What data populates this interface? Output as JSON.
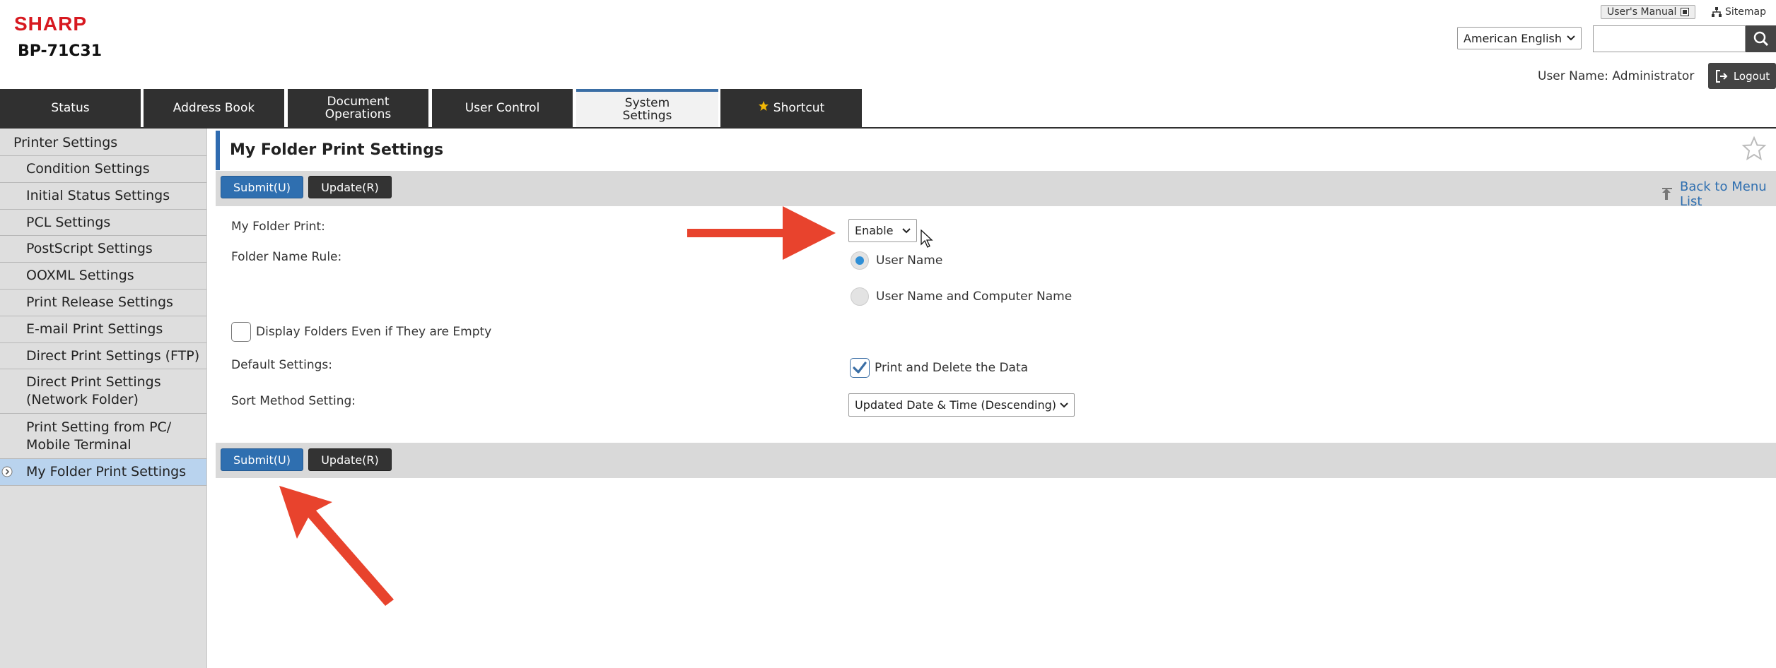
{
  "header": {
    "logo": "SHARP",
    "model": "BP-71C31",
    "user_manual": "User's Manual",
    "sitemap": "Sitemap",
    "language": "American English",
    "search_placeholder": "",
    "user_name_line": "User Name: Administrator",
    "logout": "Logout"
  },
  "tabs": [
    {
      "label": "Status",
      "active": false
    },
    {
      "label": "Address Book",
      "active": false
    },
    {
      "label": "Document\nOperations",
      "active": false
    },
    {
      "label": "User Control",
      "active": false
    },
    {
      "label": "System\nSettings",
      "active": true
    },
    {
      "label": "Shortcut",
      "active": false
    }
  ],
  "sidebar": {
    "items": [
      {
        "label": "Printer Settings"
      },
      {
        "label": "Condition Settings"
      },
      {
        "label": "Initial Status Settings"
      },
      {
        "label": "PCL Settings"
      },
      {
        "label": "PostScript Settings"
      },
      {
        "label": "OOXML Settings"
      },
      {
        "label": "Print Release Settings"
      },
      {
        "label": "E-mail Print Settings"
      },
      {
        "label": "Direct Print Settings (FTP)"
      },
      {
        "label": "Direct Print Settings\n(Network Folder)"
      },
      {
        "label": "Print Setting from PC/\nMobile Terminal"
      },
      {
        "label": "My Folder Print Settings",
        "active": true
      }
    ]
  },
  "main": {
    "title": "My Folder Print Settings",
    "submit": "Submit(U)",
    "update": "Update(R)",
    "back_to_menu": "Back to Menu List",
    "fields": {
      "my_folder_print_label": "My Folder Print:",
      "my_folder_print_value": "Enable",
      "folder_name_rule_label": "Folder Name Rule:",
      "radio_user_name": "User Name",
      "radio_user_name_computer": "User Name and Computer Name",
      "radio_selected": "User Name",
      "display_empty_folders": "Display Folders Even if They are Empty",
      "display_empty_folders_checked": false,
      "default_settings_label": "Default Settings:",
      "print_and_delete": "Print and Delete the Data",
      "print_and_delete_checked": true,
      "sort_method_label": "Sort Method Setting:",
      "sort_method_value": "Updated Date & Time (Descending)"
    }
  },
  "colors": {
    "brand_red": "#d71920",
    "accent_blue": "#2f6fb0",
    "tab_dark": "#303030",
    "annotation_arrow": "#e8432d"
  }
}
